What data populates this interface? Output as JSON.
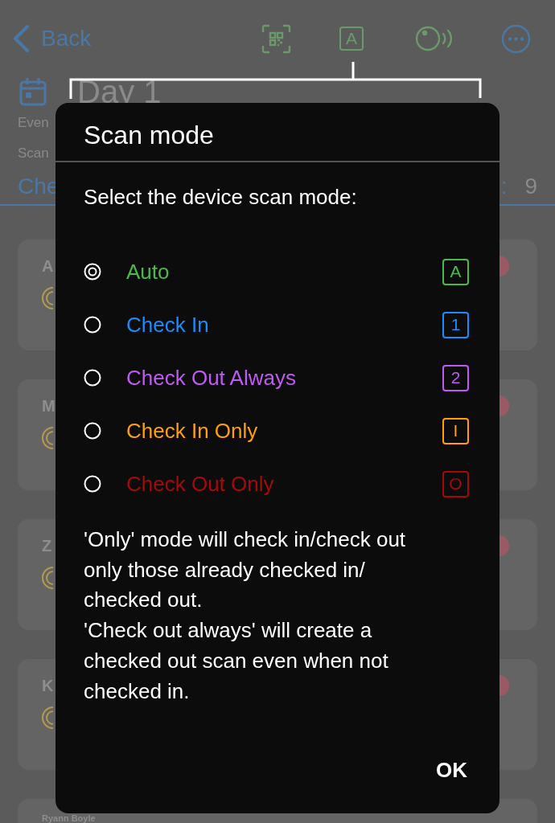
{
  "nav": {
    "back": "Back",
    "mode_badge": "A"
  },
  "header": {
    "title": "Day 1",
    "info_lines": [
      "Even",
      "Scan"
    ],
    "section": "Che",
    "count_label": ":",
    "count": "9"
  },
  "cards": [
    {
      "initial": "A"
    },
    {
      "initial": "M"
    },
    {
      "initial": "Z"
    },
    {
      "initial": "K"
    },
    {
      "initial": "Ryann Boyle"
    }
  ],
  "dialog": {
    "title": "Scan mode",
    "prompt": "Select the device scan mode:",
    "options": [
      {
        "label": "Auto",
        "badge": "A",
        "color": "#4cb84c",
        "selected": true
      },
      {
        "label": "Check In",
        "badge": "1",
        "color": "#1a8cff",
        "selected": false
      },
      {
        "label": "Check Out Always",
        "badge": "2",
        "color": "#bf5af2",
        "selected": false
      },
      {
        "label": "Check In Only",
        "badge": "I",
        "color": "#ff9f0a",
        "selected": false
      },
      {
        "label": "Check Out Only",
        "badge": "O",
        "color": "#a50a0a",
        "selected": false
      }
    ],
    "description": [
      "'Only' mode will check in/check out only those already checked in/ checked out.",
      "'Check out always' will create a checked out scan even when not checked in."
    ],
    "ok": "OK"
  }
}
